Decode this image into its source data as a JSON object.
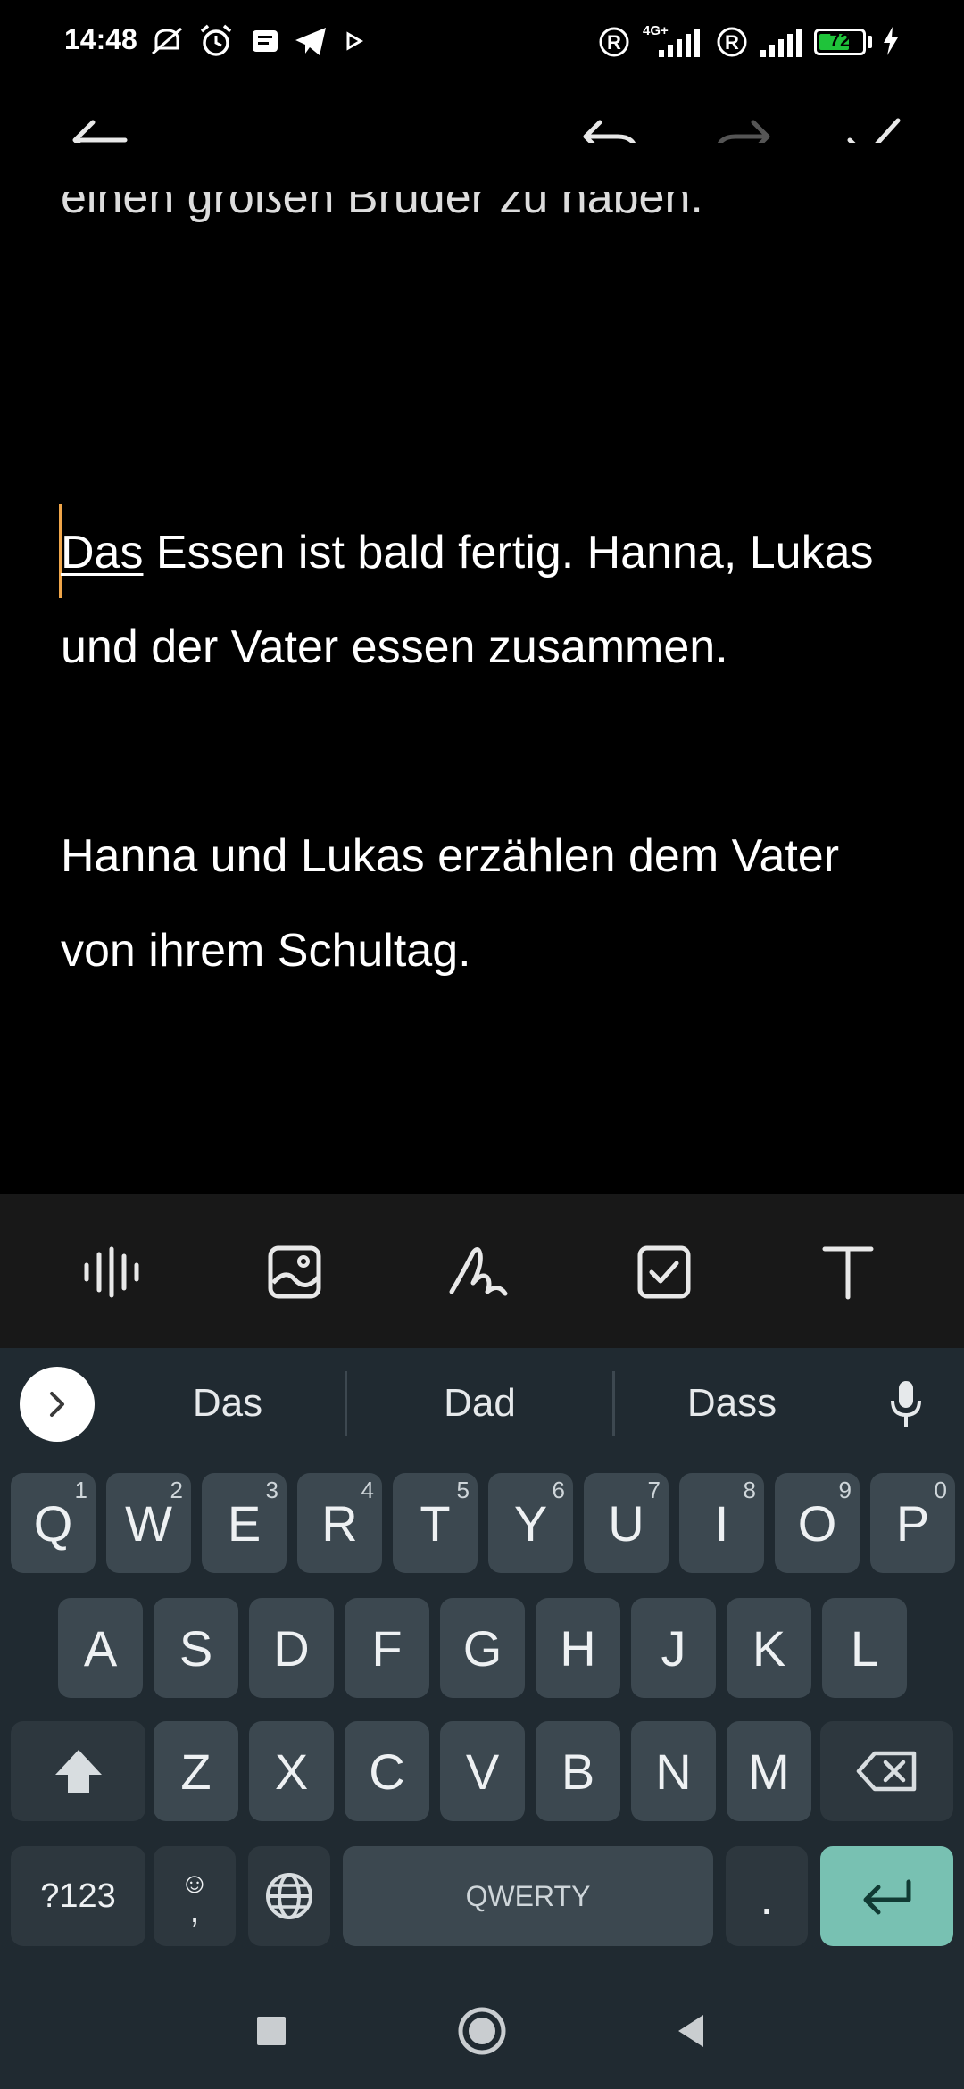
{
  "status_bar": {
    "time": "14:48",
    "network_label": "4G+",
    "battery_level": "72",
    "battery_percent": 72,
    "battery_color": "#1fc33a"
  },
  "toolbar": {
    "back_icon": "arrow-left-icon",
    "undo_icon": "undo-icon",
    "redo_icon": "redo-icon",
    "done_icon": "checkmark-icon"
  },
  "note": {
    "cutoff_line": "einen großen Bruder zu haben.",
    "paragraph1_first_word": "Das",
    "paragraph1_rest": " Essen ist bald fertig. Hanna, Lukas und der Vater essen zusammen.",
    "paragraph2": "Hanna und Lukas erzählen dem Vater von ihrem Schultag."
  },
  "format_bar": {
    "items": [
      "audio-waveform-icon",
      "image-icon",
      "handwriting-icon",
      "checkbox-icon",
      "text-format-icon"
    ]
  },
  "keyboard": {
    "suggestions": [
      "Das",
      "Dad",
      "Dass"
    ],
    "row1": [
      {
        "label": "Q",
        "hint": "1"
      },
      {
        "label": "W",
        "hint": "2"
      },
      {
        "label": "E",
        "hint": "3"
      },
      {
        "label": "R",
        "hint": "4"
      },
      {
        "label": "T",
        "hint": "5"
      },
      {
        "label": "Y",
        "hint": "6"
      },
      {
        "label": "U",
        "hint": "7"
      },
      {
        "label": "I",
        "hint": "8"
      },
      {
        "label": "O",
        "hint": "9"
      },
      {
        "label": "P",
        "hint": "0"
      }
    ],
    "row2": [
      "A",
      "S",
      "D",
      "F",
      "G",
      "H",
      "J",
      "K",
      "L"
    ],
    "row3": [
      "Z",
      "X",
      "C",
      "V",
      "B",
      "N",
      "M"
    ],
    "symbols_label": "?123",
    "emoji_label": "☺",
    "comma_label": ",",
    "space_label": "QWERTY",
    "period_label": ".",
    "accent_color": "#78c1b2"
  },
  "nav_bar": {
    "recents_icon": "square-icon",
    "home_icon": "circle-icon",
    "back_icon": "triangle-back-icon"
  }
}
